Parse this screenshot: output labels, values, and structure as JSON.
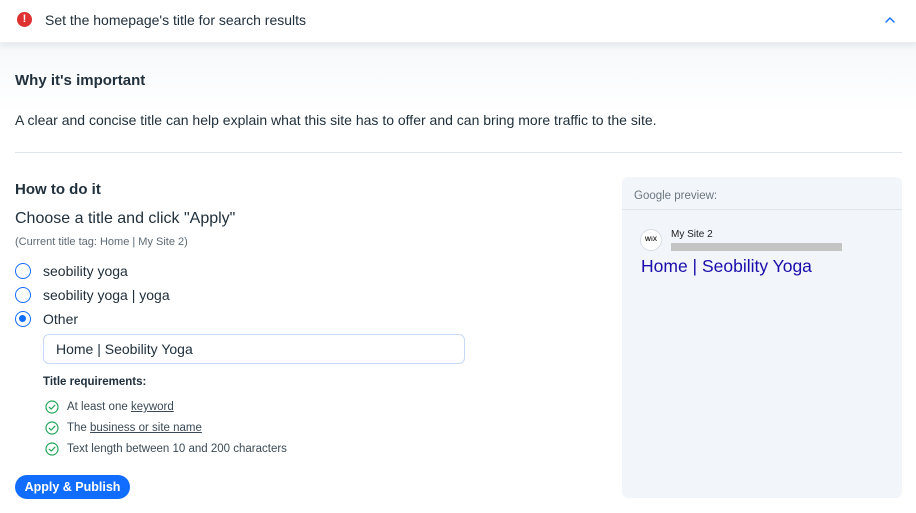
{
  "header": {
    "error_icon_glyph": "!",
    "title": "Set the homepage's title for search results",
    "collapse_icon": "chevron-up-icon"
  },
  "why": {
    "title": "Why it's important",
    "text": "A clear and concise title can help explain what this site has to offer and can bring more traffic to the site."
  },
  "how": {
    "title": "How to do it",
    "instruction": "Choose a title and click \"Apply\"",
    "current_tag": "(Current title tag: Home | My Site 2)",
    "options": [
      {
        "label": "seobility yoga",
        "selected": false
      },
      {
        "label": "seobility yoga | yoga",
        "selected": false
      },
      {
        "label": "Other",
        "selected": true
      }
    ],
    "input_value": "Home | Seobility Yoga"
  },
  "requirements": {
    "title": "Title requirements:",
    "items": [
      {
        "prefix": "At least one ",
        "link": "keyword",
        "suffix": "",
        "met": true
      },
      {
        "prefix": "The ",
        "link": "business or site name",
        "suffix": "",
        "met": true
      },
      {
        "prefix": "Text length between 10 and 200 characters",
        "link": "",
        "suffix": "",
        "met": true
      }
    ]
  },
  "apply_button": "Apply & Publish",
  "preview": {
    "label": "Google preview:",
    "logo_text": "WiX",
    "site_name": "My Site 2",
    "page_title": "Home | Seobility Yoga"
  },
  "colors": {
    "accent": "#116dff",
    "error": "#df3131",
    "success": "#25a55a",
    "serp_link": "#1a0dab",
    "text": "#20303c"
  }
}
